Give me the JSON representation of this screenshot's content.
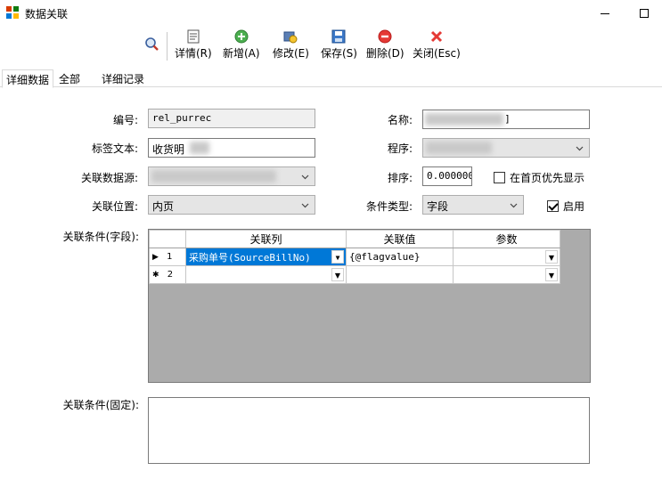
{
  "window": {
    "title": "数据关联"
  },
  "toolbar": {
    "search_value": "",
    "buttons": [
      {
        "label": "详情(R)",
        "icon": "details-icon"
      },
      {
        "label": "新增(A)",
        "icon": "add-icon"
      },
      {
        "label": "修改(E)",
        "icon": "edit-icon"
      },
      {
        "label": "保存(S)",
        "icon": "save-icon"
      },
      {
        "label": "删除(D)",
        "icon": "delete-icon"
      },
      {
        "label": "关闭(Esc)",
        "icon": "close-icon"
      }
    ]
  },
  "tabs": [
    "详细数据",
    "全部",
    "详细记录"
  ],
  "form": {
    "code_label": "编号:",
    "code_value": "rel_purrec",
    "name_label": "名称:",
    "name_value": "]",
    "tag_label": "标签文本:",
    "tag_value": "收货明",
    "program_label": "程序:",
    "program_value": "",
    "source_label": "关联数据源:",
    "source_value": "",
    "order_label": "排序:",
    "order_value": "0.0000000",
    "priority_label": "在首页优先显示",
    "priority_checked": false,
    "position_label": "关联位置:",
    "position_value": "内页",
    "condtype_label": "条件类型:",
    "condtype_value": "字段",
    "enabled_label": "启用",
    "enabled_checked": true,
    "cond_field_label": "关联条件(字段):",
    "cond_fixed_label": "关联条件(固定):",
    "cond_fixed_value": ""
  },
  "grid": {
    "columns": [
      "关联列",
      "关联值",
      "参数"
    ],
    "rows": [
      {
        "marker": "▶",
        "num": "1",
        "col": "采购单号(SourceBillNo)",
        "val": "{@flagvalue}",
        "param": ""
      },
      {
        "marker": "✱",
        "num": "2",
        "col": "",
        "val": "",
        "param": ""
      }
    ]
  }
}
